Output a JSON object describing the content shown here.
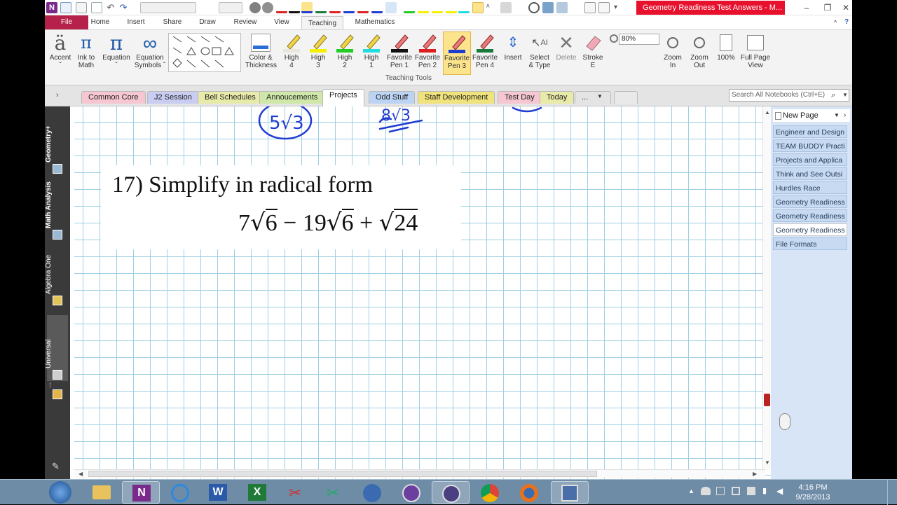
{
  "window": {
    "title": "Geometry Readiness Test Answers - M...",
    "minimize_glyph": "–",
    "restore_glyph": "❐",
    "close_glyph": "✕"
  },
  "ribbon_tabs": [
    {
      "label": "File"
    },
    {
      "label": "Home"
    },
    {
      "label": "Insert"
    },
    {
      "label": "Share"
    },
    {
      "label": "Draw"
    },
    {
      "label": "Review"
    },
    {
      "label": "View"
    },
    {
      "label": "Teaching"
    },
    {
      "label": "Mathematics"
    }
  ],
  "ribbon": {
    "accent": {
      "glyph": "ä",
      "label1": "Accent",
      "label2": "ˇ"
    },
    "ink_to_math": {
      "glyph": "π",
      "label1": "Ink to",
      "label2": "Math"
    },
    "equation": {
      "glyph": "π",
      "label1": "Equation",
      "label2": "ˇ"
    },
    "equation_symbols": {
      "glyph": "∞",
      "label1": "Equation",
      "label2": "Symbols ˇ"
    },
    "color_thickness": {
      "label1": "Color &",
      "label2": "Thickness"
    },
    "pens": [
      {
        "label1": "High",
        "label2": "4",
        "color": "#e9e6dc"
      },
      {
        "label1": "High",
        "label2": "3",
        "color": "#f4f000"
      },
      {
        "label1": "High",
        "label2": "2",
        "color": "#22cc22"
      },
      {
        "label1": "High",
        "label2": "1",
        "color": "#22dddd"
      },
      {
        "label1": "Favorite",
        "label2": "Pen 1",
        "color": "#111111"
      },
      {
        "label1": "Favorite",
        "label2": "Pen 2",
        "color": "#dd1e1e"
      },
      {
        "label1": "Favorite",
        "label2": "Pen 3",
        "color": "#1f3cd1"
      },
      {
        "label1": "Favorite",
        "label2": "Pen 4",
        "color": "#1a7a3a"
      }
    ],
    "insert": {
      "label1": "Insert",
      "label2": ""
    },
    "select_type": {
      "label1": "Select",
      "label2": "& Type"
    },
    "delete": {
      "label1": "Delete",
      "label2": ""
    },
    "stroke_e": {
      "label1": "Stroke",
      "label2": "E"
    },
    "zoom_value": "80%",
    "zoom_in": {
      "label1": "Zoom",
      "label2": "In"
    },
    "zoom_out": {
      "label1": "Zoom",
      "label2": "Out"
    },
    "zoom100": {
      "label1": "100%",
      "label2": ""
    },
    "full_page": {
      "label1": "Full Page",
      "label2": "View"
    },
    "group_label": "Teaching Tools"
  },
  "sections": [
    {
      "label": "Common Core",
      "color": "#f6c7d3"
    },
    {
      "label": "J2 Session",
      "color": "#c9cdf2"
    },
    {
      "label": "Bell Schedules",
      "color": "#e8eaa9"
    },
    {
      "label": "Annoucements",
      "color": "#cfe8a9"
    },
    {
      "label": "Projects",
      "color": "#ffffff"
    },
    {
      "label": "Odd Stuff",
      "color": "#bcd4f4"
    },
    {
      "label": "Staff Development",
      "color": "#f1e37c"
    },
    {
      "label": "Test Day",
      "color": "#f6c7d3"
    },
    {
      "label": "Today",
      "color": "#e8eaa9"
    },
    {
      "label": "...",
      "color": "#e4e4e4"
    }
  ],
  "search": {
    "placeholder": "Search All Notebooks (Ctrl+E)"
  },
  "notebooks": [
    {
      "label": "Geometry+"
    },
    {
      "label": "Math Analysis"
    },
    {
      "label": "Algebra One"
    },
    {
      "label": "Universal"
    },
    {
      "label": "..."
    }
  ],
  "pages_panel": {
    "new_page": "New Page",
    "pages": [
      {
        "label": "Engineer and Design"
      },
      {
        "label": "TEAM BUDDY Practi"
      },
      {
        "label": "Projects and Applica"
      },
      {
        "label": "Think and See Outsi"
      },
      {
        "label": "Hurdles Race"
      },
      {
        "label": "Geometry Readiness"
      },
      {
        "label": "Geometry Readiness"
      },
      {
        "label": "Geometry Readiness"
      },
      {
        "label": "File Formats"
      }
    ]
  },
  "problem": {
    "number": "17)",
    "instruction": "Simplify  in radical form",
    "t1": "7",
    "r1": "6",
    "op1": "−",
    "t2": "19",
    "r2": "6",
    "op2": "+",
    "r3": "24"
  },
  "handwriting": {
    "a": "5√3",
    "b": "8√3"
  },
  "taskbar": {
    "time": "4:16 PM",
    "date": "9/28/2013"
  }
}
